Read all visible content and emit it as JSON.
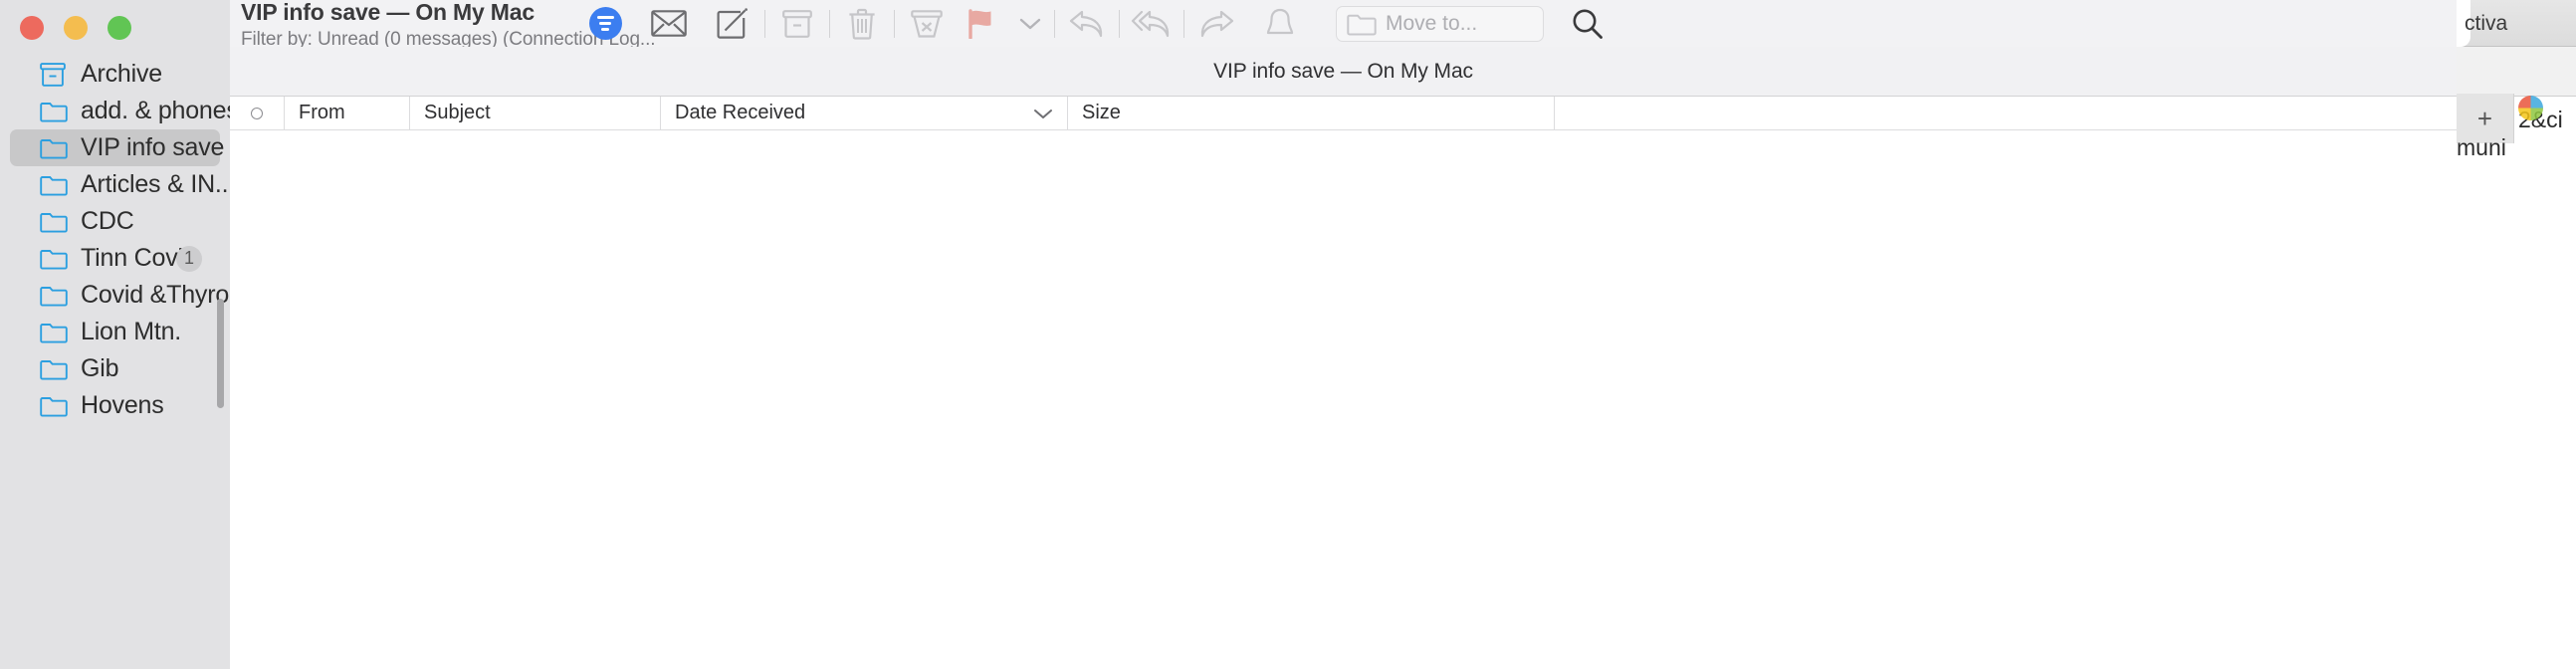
{
  "window": {
    "traffic_lights": [
      "close",
      "minimize",
      "zoom"
    ],
    "colors": {
      "close": "#ed6a5e",
      "minimize": "#f4bd4f",
      "zoom": "#61c554",
      "accent_blue": "#3c7ef0",
      "flag_red": "#e8a9a2",
      "sidebar_bg": "#e2e2e4",
      "folder_icon": "#2b9fe0"
    }
  },
  "sidebar": {
    "items": [
      {
        "label": "Archive",
        "icon": "archive-box-icon",
        "selected": false,
        "badge": ""
      },
      {
        "label": "add. & phones",
        "icon": "folder-icon",
        "selected": false,
        "badge": ""
      },
      {
        "label": "VIP info save",
        "icon": "folder-icon",
        "selected": true,
        "badge": ""
      },
      {
        "label": "Articles & IN...",
        "icon": "folder-icon",
        "selected": false,
        "badge": ""
      },
      {
        "label": "CDC",
        "icon": "folder-icon",
        "selected": false,
        "badge": ""
      },
      {
        "label": "Tinn Covid",
        "icon": "folder-icon",
        "selected": false,
        "badge": "1"
      },
      {
        "label": "Covid &Thyro...",
        "icon": "folder-icon",
        "selected": false,
        "badge": ""
      },
      {
        "label": "Lion Mtn.",
        "icon": "folder-icon",
        "selected": false,
        "badge": ""
      },
      {
        "label": "Gib",
        "icon": "folder-icon",
        "selected": false,
        "badge": ""
      },
      {
        "label": "Hovens",
        "icon": "folder-icon",
        "selected": false,
        "badge": ""
      }
    ]
  },
  "toolbar": {
    "title": "VIP info save — On My Mac",
    "subtitle": "Filter by: Unread (0 messages) (Connection Log...",
    "buttons": [
      {
        "name": "filter-button",
        "icon": "filter-lines-icon",
        "enabled": true
      },
      {
        "name": "get-mail-button",
        "icon": "envelope-icon",
        "enabled": true
      },
      {
        "name": "compose-button",
        "icon": "compose-pencil-icon",
        "enabled": true
      },
      {
        "name": "archive-button",
        "icon": "archive-box-icon",
        "enabled": false
      },
      {
        "name": "delete-button",
        "icon": "trash-icon",
        "enabled": false
      },
      {
        "name": "junk-button",
        "icon": "junk-bin-icon",
        "enabled": false
      },
      {
        "name": "flag-button",
        "icon": "flag-icon",
        "enabled": false
      },
      {
        "name": "flag-menu-button",
        "icon": "chevron-down-icon",
        "enabled": false
      },
      {
        "name": "reply-button",
        "icon": "reply-arrow-icon",
        "enabled": false
      },
      {
        "name": "reply-all-button",
        "icon": "reply-all-arrow-icon",
        "enabled": false
      },
      {
        "name": "forward-button",
        "icon": "forward-arrow-icon",
        "enabled": false
      },
      {
        "name": "mute-button",
        "icon": "bell-icon",
        "enabled": false
      }
    ],
    "move_to": {
      "placeholder": "Move to...",
      "icon": "folder-icon"
    },
    "search": {
      "icon": "search-icon"
    }
  },
  "subheader": {
    "text": "VIP info save — On My Mac"
  },
  "message_list": {
    "columns": [
      {
        "label": "",
        "name": "unread-column",
        "icon": "unread-circle-icon",
        "sortable": true
      },
      {
        "label": "From",
        "name": "from-column",
        "sortable": true
      },
      {
        "label": "Subject",
        "name": "subject-column",
        "sortable": true
      },
      {
        "label": "Date Received",
        "name": "date-column",
        "sortable": true,
        "sorted": true
      },
      {
        "label": "Size",
        "name": "size-column",
        "sortable": true
      }
    ],
    "rows": [],
    "empty": true
  },
  "background_window": {
    "tab_text": "ctiva",
    "url_text": "2&ci",
    "bookmark_text": "muni",
    "new_tab_label": "+"
  }
}
